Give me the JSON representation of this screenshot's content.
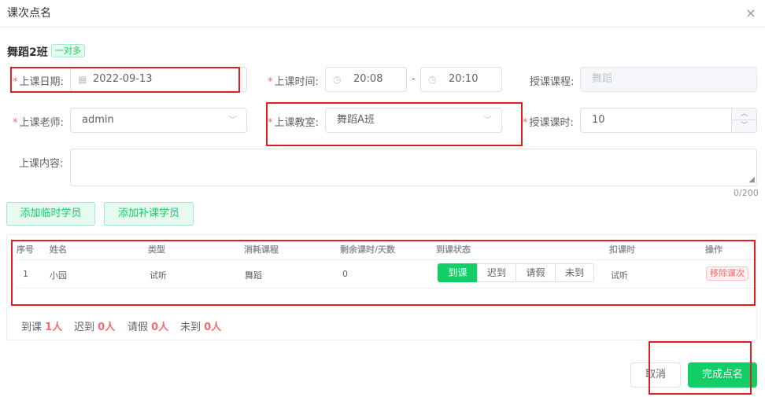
{
  "dialog": {
    "title": "课次点名"
  },
  "class_info": {
    "name": "舞蹈2班",
    "tag": "一对多"
  },
  "form": {
    "date_label": "上课日期:",
    "date_value": "2022-09-13",
    "time_label": "上课时间:",
    "time_start": "20:08",
    "time_sep": "-",
    "time_end": "20:10",
    "course_label": "授课课程:",
    "course_value": "舞蹈",
    "teacher_label": "上课老师:",
    "teacher_value": "admin",
    "classroom_label": "上课教室:",
    "classroom_value": "舞蹈A班",
    "hours_label": "授课课时:",
    "hours_value": "10",
    "content_label": "上课内容:",
    "content_value": "",
    "content_counter": "0/200",
    "required_mark": "*"
  },
  "actions": {
    "add_temp": "添加临时学员",
    "add_makeup": "添加补课学员"
  },
  "table": {
    "columns": [
      "序号",
      "姓名",
      "类型",
      "消耗课程",
      "剩余课时/天数",
      "到课状态",
      "扣课时",
      "操作"
    ],
    "rows": [
      {
        "index": "1",
        "name": "小园",
        "type": "试听",
        "course": "舞蹈",
        "remaining": "0",
        "deduct": "试听",
        "remove": "移除课次"
      }
    ],
    "status_options": [
      "到课",
      "迟到",
      "请假",
      "未到"
    ],
    "status_selected": "到课"
  },
  "stats": {
    "present_label": "到课",
    "present_value": "1人",
    "late_label": "迟到",
    "late_value": "0人",
    "leave_label": "请假",
    "leave_value": "0人",
    "absent_label": "未到",
    "absent_value": "0人"
  },
  "footer": {
    "cancel": "取消",
    "confirm": "完成点名"
  },
  "colors": {
    "accent": "#13ce66",
    "danger": "#f56c6c",
    "annotation": "#e02020"
  },
  "icons": {
    "close": "close-icon",
    "calendar": "calendar-icon",
    "clock": "clock-icon",
    "chevron": "chevron-down-icon",
    "stepper_up": "chevron-up-icon",
    "stepper_down": "chevron-down-icon"
  }
}
